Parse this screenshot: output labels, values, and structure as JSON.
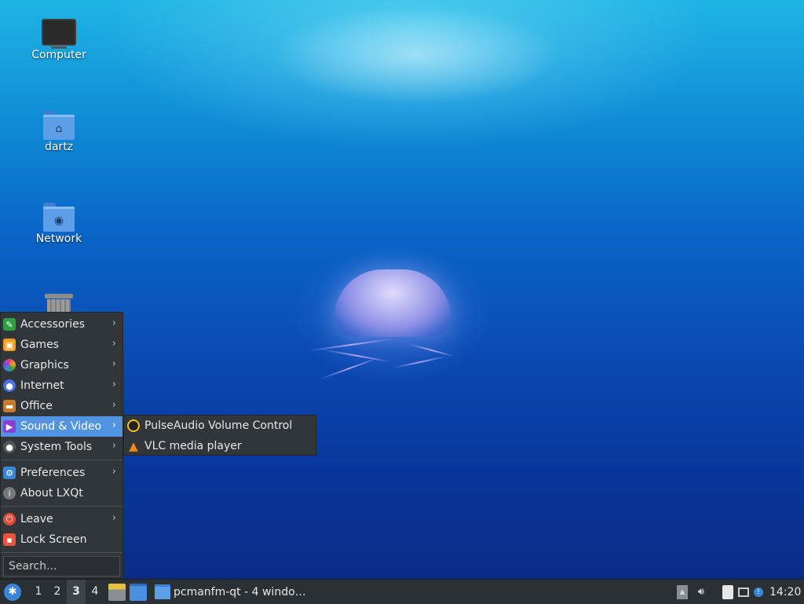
{
  "desktop": {
    "icons": [
      {
        "label": "Computer",
        "icon": "computer-icon"
      },
      {
        "label": "dartz",
        "icon": "home-folder-icon"
      },
      {
        "label": "Network",
        "icon": "network-folder-icon"
      },
      {
        "label": "",
        "icon": "trash-icon"
      }
    ]
  },
  "menu": {
    "items": [
      {
        "label": "Accessories",
        "icon": "accessories-icon",
        "color": "#2ea043",
        "submenu": true
      },
      {
        "label": "Games",
        "icon": "games-icon",
        "color": "#f0a020",
        "submenu": true
      },
      {
        "label": "Graphics",
        "icon": "graphics-icon",
        "color": "#e0457b",
        "submenu": true
      },
      {
        "label": "Internet",
        "icon": "internet-icon",
        "color": "#4a6fe0",
        "submenu": true
      },
      {
        "label": "Office",
        "icon": "office-icon",
        "color": "#c87a2a",
        "submenu": true
      },
      {
        "label": "Sound & Video",
        "icon": "sound-video-icon",
        "color": "#8a3fd6",
        "submenu": true,
        "active": true
      },
      {
        "label": "System Tools",
        "icon": "system-tools-icon",
        "color": "#cccccc",
        "submenu": true
      },
      {
        "label": "Preferences",
        "icon": "preferences-icon",
        "color": "#3a86d6",
        "submenu": true
      },
      {
        "label": "About LXQt",
        "icon": "info-icon",
        "color": "#777777",
        "submenu": false
      },
      {
        "label": "Leave",
        "icon": "power-icon",
        "color": "#e04b3a",
        "submenu": true
      },
      {
        "label": "Lock Screen",
        "icon": "lock-icon",
        "color": "#e8553a",
        "submenu": false
      }
    ],
    "search_placeholder": "Search..."
  },
  "submenu": {
    "items": [
      {
        "label": "PulseAudio Volume Control",
        "icon": "pulseaudio-icon"
      },
      {
        "label": "VLC media player",
        "icon": "vlc-icon"
      }
    ]
  },
  "taskbar": {
    "workspaces": [
      "1",
      "2",
      "3",
      "4"
    ],
    "active_workspace": "3",
    "task_label": "pcmanfm-qt - 4 windo…",
    "clock": "14:20"
  },
  "colors": {
    "menu_bg": "#31363b",
    "highlight": "#5294e2",
    "taskbar_bg": "#2b3035"
  }
}
